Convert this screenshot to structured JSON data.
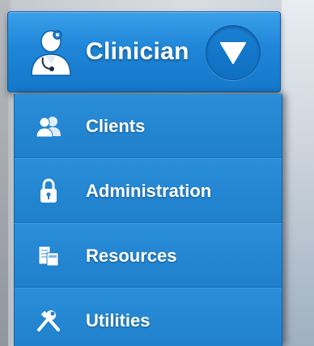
{
  "header": {
    "title": "Clinician",
    "user_icon": "clinician-avatar-icon",
    "toggle_icon": "triangle-down-icon"
  },
  "menu": {
    "items": [
      {
        "label": "Clients",
        "icon": "clients-icon"
      },
      {
        "label": "Administration",
        "icon": "lock-icon"
      },
      {
        "label": "Resources",
        "icon": "resources-icon"
      },
      {
        "label": "Utilities",
        "icon": "tools-icon"
      }
    ]
  },
  "colors": {
    "accent": "#1f86d8",
    "text": "#ffffff"
  }
}
